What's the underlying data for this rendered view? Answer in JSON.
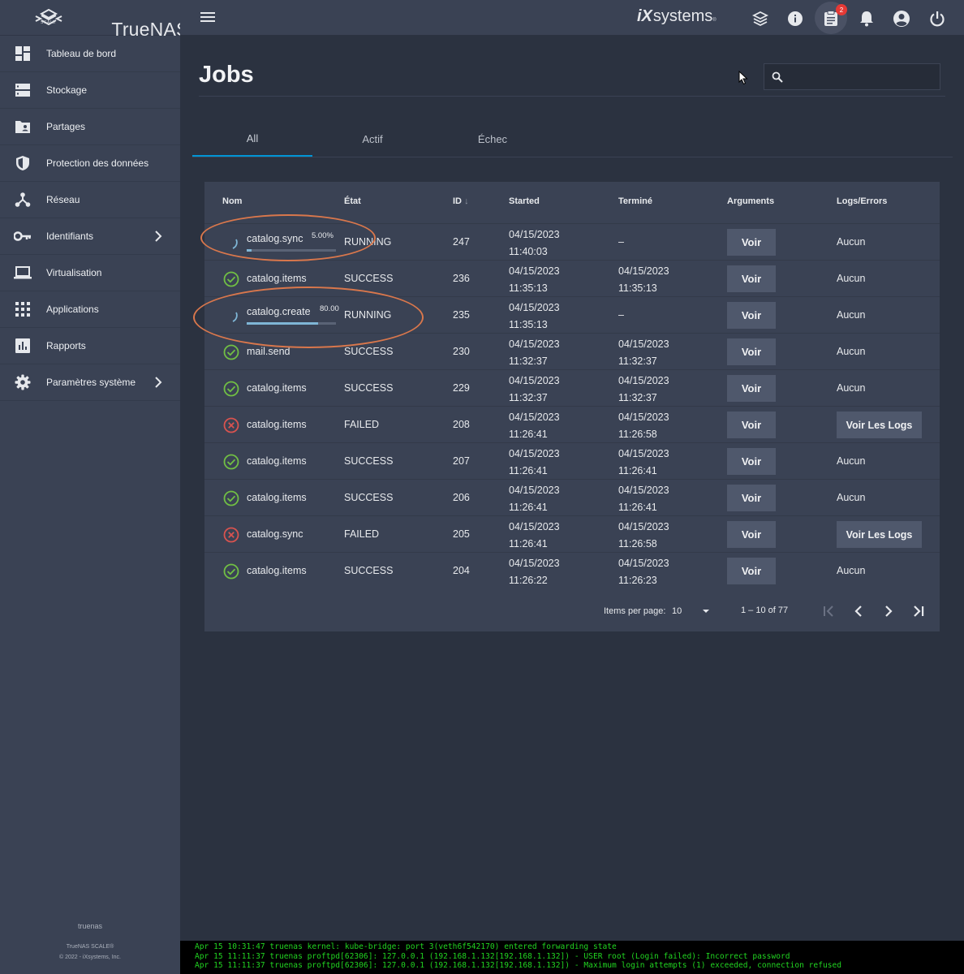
{
  "brand": {
    "name": "TrueNAS",
    "edition": "SCALE"
  },
  "sidebar": {
    "items": [
      {
        "label": "Tableau de bord",
        "icon": "dashboard-icon"
      },
      {
        "label": "Stockage",
        "icon": "storage-icon"
      },
      {
        "label": "Partages",
        "icon": "folder-shared-icon"
      },
      {
        "label": "Protection des données",
        "icon": "shield-icon"
      },
      {
        "label": "Réseau",
        "icon": "network-icon"
      },
      {
        "label": "Identifiants",
        "icon": "key-icon",
        "chevron": true
      },
      {
        "label": "Virtualisation",
        "icon": "laptop-icon"
      },
      {
        "label": "Applications",
        "icon": "apps-grid-icon"
      },
      {
        "label": "Rapports",
        "icon": "insert-chart-icon"
      },
      {
        "label": "Paramètres système",
        "icon": "gear-icon",
        "chevron": true
      }
    ],
    "footer": {
      "hostname": "truenas",
      "version": "TrueNAS SCALE®",
      "copyright": "© 2022 - iXsystems, Inc."
    }
  },
  "topbar": {
    "vendor_ix": "iX",
    "vendor_systems": "systems",
    "vendor_tm": "®",
    "task_badge": "2",
    "icons": [
      "menu-icon",
      "truecommand-icon",
      "info-icon",
      "clipboard-icon",
      "bell-icon",
      "account-icon",
      "power-icon"
    ]
  },
  "page": {
    "title": "Jobs",
    "search_value": ""
  },
  "tabs": [
    {
      "label": "All",
      "active": true
    },
    {
      "label": "Actif"
    },
    {
      "label": "Échec"
    }
  ],
  "table": {
    "headers": {
      "name": "Nom",
      "state": "État",
      "id": "ID",
      "id_sort": "↓",
      "started": "Started",
      "finished": "Terminé",
      "arguments": "Arguments",
      "logs": "Logs/Errors"
    },
    "rows": [
      {
        "status": "running",
        "name": "catalog.sync",
        "progress": "5.00%",
        "progress_value": 0.05,
        "state": "RUNNING",
        "id": "247",
        "started_date": "04/15/2023",
        "started_time": "11:40:03",
        "finished_date": "–",
        "finished_time": "",
        "args": "Voir",
        "logs": "Aucun"
      },
      {
        "status": "success",
        "name": "catalog.items",
        "state": "SUCCESS",
        "id": "236",
        "started_date": "04/15/2023",
        "started_time": "11:35:13",
        "finished_date": "04/15/2023",
        "finished_time": "11:35:13",
        "args": "Voir",
        "logs": "Aucun"
      },
      {
        "status": "running",
        "name": "catalog.create",
        "progress": "80.00",
        "progress_value": 0.8,
        "state": "RUNNING",
        "id": "235",
        "started_date": "04/15/2023",
        "started_time": "11:35:13",
        "finished_date": "–",
        "finished_time": "",
        "args": "Voir",
        "logs": "Aucun"
      },
      {
        "status": "success",
        "name": "mail.send",
        "state": "SUCCESS",
        "id": "230",
        "started_date": "04/15/2023",
        "started_time": "11:32:37",
        "finished_date": "04/15/2023",
        "finished_time": "11:32:37",
        "args": "Voir",
        "logs": "Aucun"
      },
      {
        "status": "success",
        "name": "catalog.items",
        "state": "SUCCESS",
        "id": "229",
        "started_date": "04/15/2023",
        "started_time": "11:32:37",
        "finished_date": "04/15/2023",
        "finished_time": "11:32:37",
        "args": "Voir",
        "logs": "Aucun"
      },
      {
        "status": "failed",
        "name": "catalog.items",
        "state": "FAILED",
        "id": "208",
        "started_date": "04/15/2023",
        "started_time": "11:26:41",
        "finished_date": "04/15/2023",
        "finished_time": "11:26:58",
        "args": "Voir",
        "logs_button": "Voir Les Logs"
      },
      {
        "status": "success",
        "name": "catalog.items",
        "state": "SUCCESS",
        "id": "207",
        "started_date": "04/15/2023",
        "started_time": "11:26:41",
        "finished_date": "04/15/2023",
        "finished_time": "11:26:41",
        "args": "Voir",
        "logs": "Aucun"
      },
      {
        "status": "success",
        "name": "catalog.items",
        "state": "SUCCESS",
        "id": "206",
        "started_date": "04/15/2023",
        "started_time": "11:26:41",
        "finished_date": "04/15/2023",
        "finished_time": "11:26:41",
        "args": "Voir",
        "logs": "Aucun"
      },
      {
        "status": "failed",
        "name": "catalog.sync",
        "state": "FAILED",
        "id": "205",
        "started_date": "04/15/2023",
        "started_time": "11:26:41",
        "finished_date": "04/15/2023",
        "finished_time": "11:26:58",
        "args": "Voir",
        "logs_button": "Voir Les Logs"
      },
      {
        "status": "success",
        "name": "catalog.items",
        "state": "SUCCESS",
        "id": "204",
        "started_date": "04/15/2023",
        "started_time": "11:26:22",
        "finished_date": "04/15/2023",
        "finished_time": "11:26:23",
        "args": "Voir",
        "logs": "Aucun"
      }
    ]
  },
  "paginator": {
    "items_per_page_label": "Items per page:",
    "items_per_page": "10",
    "range": "1 – 10 of 77"
  },
  "console": {
    "lines": [
      "Apr 15 10:31:47 truenas kernel: kube-bridge: port 3(veth6f542170) entered forwarding state",
      "Apr 15 11:11:37 truenas proftpd[62306]: 127.0.0.1 (192.168.1.132[192.168.1.132]) - USER root (Login failed): Incorrect password",
      "Apr 15 11:11:37 truenas proftpd[62306]: 127.0.0.1 (192.168.1.132[192.168.1.132]) - Maximum login attempts (1) exceeded, connection refused"
    ]
  },
  "colors": {
    "accent": "#0095d5",
    "success": "#71bf44",
    "failed": "#d9534f",
    "annotation": "#d9774c",
    "console_text": "#21d321"
  }
}
